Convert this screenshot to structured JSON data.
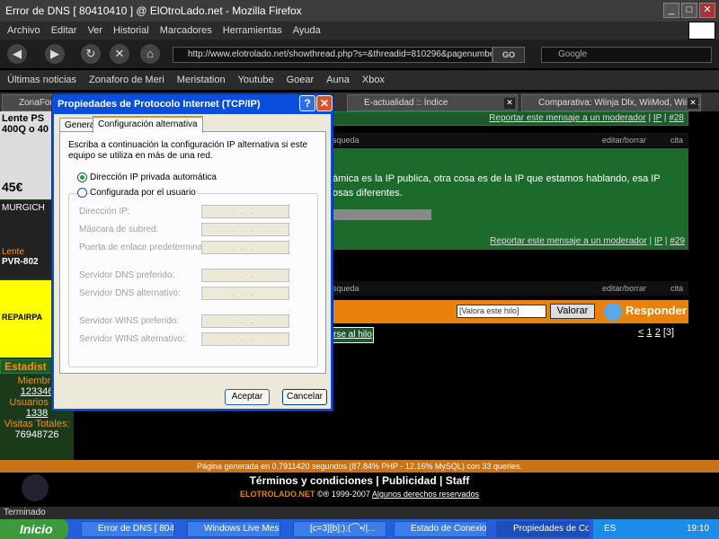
{
  "window": {
    "title": "Error de DNS [ 80410410 ] @ ElOtroLado.net - Mozilla Firefox"
  },
  "menu": [
    "Archivo",
    "Editar",
    "Ver",
    "Historial",
    "Marcadores",
    "Herramientas",
    "Ayuda"
  ],
  "nav": {
    "url": "http://www.elotrolado.net/showthread.php?s=&threadid=810296&pagenumber=",
    "go": "GO",
    "search_placeholder": "Google"
  },
  "bookmarks": [
    "Últimas noticias",
    "Zonaforo de Meri",
    "Meristation",
    "Youtube",
    "Goear",
    "Auna",
    "Xbox"
  ],
  "tabs": [
    "ZonaForo",
    "E-actualidad :: Índice",
    "Comparativa: Wiinja Dlx, WiiMod, WiiK..."
  ],
  "forum": {
    "report1": "Reportar este mensaje a un moderador",
    "ip": "IP",
    "post1": "#28",
    "post2": "#29",
    "search": "squeda",
    "edit": "editar/borrar",
    "quote": "cita",
    "text_line1": "ámica es la IP publica, otra cosa es de la IP que estamos hablando, esa IP",
    "text_line2": "osas diferentes.",
    "rate_select": "[Valora este hilo]",
    "rate_btn": "Valorar",
    "reply_btn": "Responder",
    "back_to_thread": "rse al hilo",
    "pages": [
      "<",
      "1",
      "2",
      "[3]"
    ],
    "left_ads": [
      "Lente PS",
      "400Q o 40",
      "45€",
      "MURGICH",
      "Lente",
      "PVR-802",
      "REPAIRPA"
    ],
    "stats_title": "Estadist",
    "stats": [
      {
        "label": "Miembro",
        "value": "123346"
      },
      {
        "label": "Usuarios On",
        "value": "1338"
      },
      {
        "label": "Visitas Totales:",
        "value": "76948726"
      }
    ],
    "footer_gen": "Página generada en 0.7911420 segundos (87.84% PHP - 12.16% MySQL) con 33 queries.",
    "footer_links": [
      "Términos y condiciones",
      "Publicidad",
      "Staff"
    ],
    "footer_site": "ELOTROLADO.NET",
    "footer_copy": "©® 1999-2007",
    "footer_rights": "Algunos derechos reservados"
  },
  "dialog": {
    "title": "Propiedades de Protocolo Internet (TCP/IP)",
    "help": "?",
    "close": "✕",
    "tab_general": "General",
    "tab_alt": "Configuración alternativa",
    "intro": "Escriba a continuación la configuración IP alternativa si este equipo se utiliza en más de una red.",
    "radio_auto": "Dirección IP privada automática",
    "radio_user": "Configurada por el usuario",
    "fields": [
      "Dirección IP:",
      "Máscara de subred:",
      "Puerta de enlace predeterminada:",
      "Servidor DNS preferido:",
      "Servidor DNS alternativo:",
      "Servidor WINS preferido:",
      "Servidor WINS alternativo:"
    ],
    "ip_placeholder": "...",
    "ok": "Aceptar",
    "cancel": "Cancelar"
  },
  "statusbar": "Terminado",
  "taskbar": {
    "start": "Inicio",
    "tasks": [
      "Error de DNS [ 804...",
      "Windows Live Mess...",
      "[c=3][b];);(⌒•/|...",
      "Estado de Conexio...",
      "Propiedades de Co..."
    ],
    "lang": "ES",
    "time": "19:10"
  }
}
